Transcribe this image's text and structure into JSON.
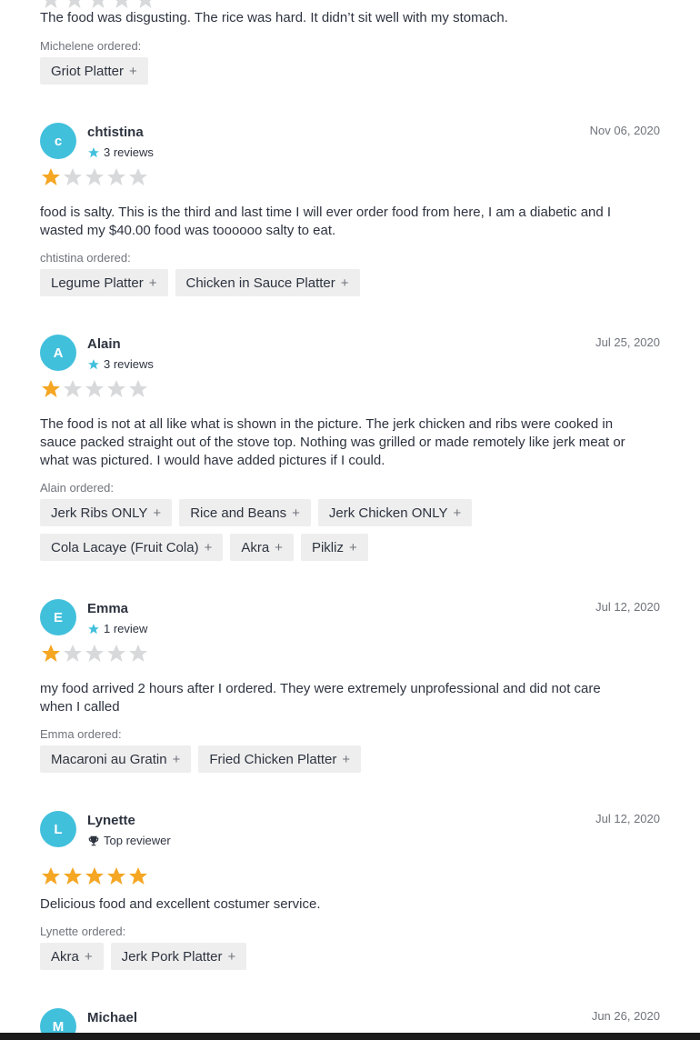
{
  "colors": {
    "avatar": "#41c0dc",
    "star_filled": "#f5a623",
    "star_empty": "#d8d9db",
    "pill_bg": "#eeeeee"
  },
  "top_review": {
    "text": "The food was disgusting. The rice was hard. It didn’t sit well with my stomach.",
    "ordered_label": "Michelene ordered:",
    "items": [
      "Griot Platter"
    ]
  },
  "reviews": [
    {
      "initial": "c",
      "name": "chtistina",
      "meta_icon": "star-icon",
      "meta": "3 reviews",
      "date": "Nov 06, 2020",
      "rating": 1,
      "text_lines": [
        "food is salty. This is the third and last time I will ever order food from here, I am a diabetic and I",
        "wasted my $40.00 food was toooooo salty to eat."
      ],
      "ordered_label": "chtistina ordered:",
      "items": [
        "Legume Platter",
        "Chicken in Sauce Platter"
      ]
    },
    {
      "initial": "A",
      "name": "Alain",
      "meta_icon": "star-icon",
      "meta": "3 reviews",
      "date": "Jul 25, 2020",
      "rating": 1,
      "text_lines": [
        "The food is not at all like what is shown in the picture. The jerk chicken and ribs were cooked in",
        "sauce packed straight out of the stove top. Nothing was grilled or made remotely like jerk meat or",
        "what was pictured. I would have added pictures if I could."
      ],
      "ordered_label": "Alain ordered:",
      "items": [
        "Jerk Ribs ONLY",
        "Rice and Beans",
        "Jerk Chicken ONLY",
        "Cola Lacaye (Fruit Cola)",
        "Akra",
        "Pikliz"
      ]
    },
    {
      "initial": "E",
      "name": "Emma",
      "meta_icon": "star-icon",
      "meta": "1 review",
      "date": "Jul 12, 2020",
      "rating": 1,
      "text_lines": [
        "my food arrived 2 hours after I ordered. They were extremely unprofessional and did not care",
        "when I called"
      ],
      "ordered_label": "Emma ordered:",
      "items": [
        "Macaroni au Gratin",
        "Fried Chicken Platter"
      ]
    },
    {
      "initial": "L",
      "name": "Lynette",
      "meta_icon": "trophy-icon",
      "meta": "Top reviewer",
      "date": "Jul 12, 2020",
      "rating": 5,
      "text_lines": [
        "Delicious food and excellent costumer service."
      ],
      "ordered_label": "Lynette ordered:",
      "items": [
        "Akra",
        "Jerk Pork Platter"
      ]
    },
    {
      "initial": "M",
      "name": "Michael",
      "date": "Jun 26, 2020"
    }
  ]
}
